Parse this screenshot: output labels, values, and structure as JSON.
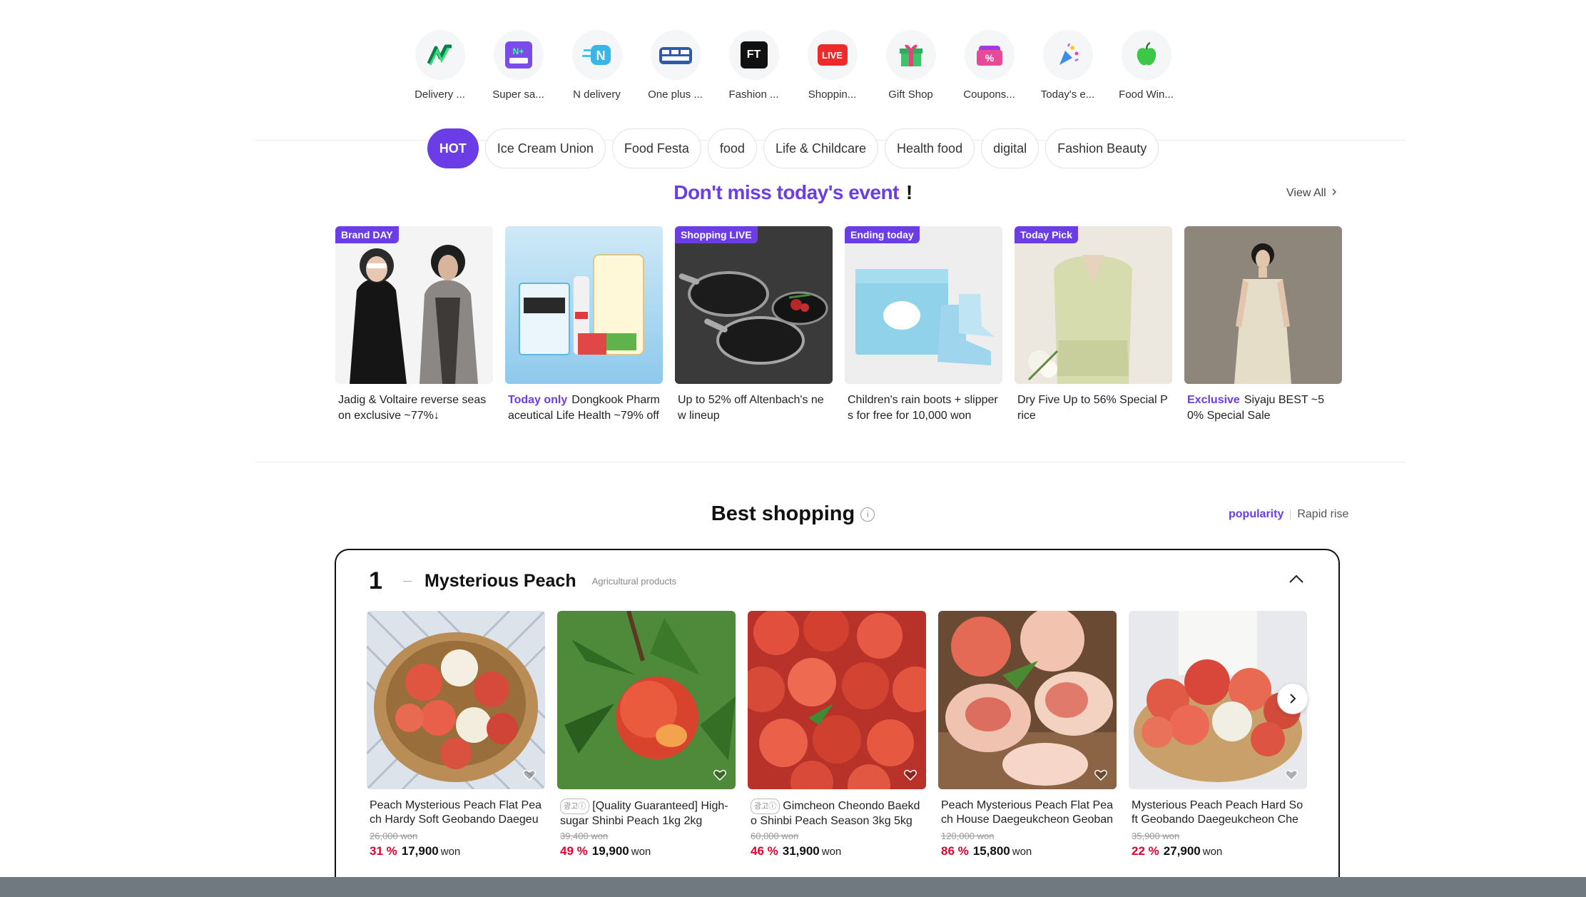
{
  "services": [
    {
      "label": "Delivery ...",
      "icon": "delivery-icon"
    },
    {
      "label": "Super sa...",
      "icon": "super-saving-icon"
    },
    {
      "label": "N delivery",
      "icon": "n-delivery-icon"
    },
    {
      "label": "One plus ...",
      "icon": "one-plus-icon"
    },
    {
      "label": "Fashion ...",
      "icon": "fashion-town-icon"
    },
    {
      "label": "Shoppin...",
      "icon": "shopping-live-icon"
    },
    {
      "label": "Gift Shop",
      "icon": "gift-icon"
    },
    {
      "label": "Coupons...",
      "icon": "coupon-icon"
    },
    {
      "label": "Today's e...",
      "icon": "party-popper-icon"
    },
    {
      "label": "Food Win...",
      "icon": "apple-icon"
    }
  ],
  "service_icon_text": {
    "ft": "FT",
    "live": "LIVE",
    "super": "N+"
  },
  "chips": [
    "HOT",
    "Ice Cream Union",
    "Food Festa",
    "food",
    "Life & Childcare",
    "Health food",
    "digital",
    "Fashion Beauty"
  ],
  "event": {
    "title": "Don't miss today's event",
    "bang": "!",
    "view_all": "View All",
    "cards": [
      {
        "badge": "Brand DAY",
        "highlight": "",
        "text": "Jadig & Voltaire reverse season exclusive ~77%↓"
      },
      {
        "badge": "",
        "highlight": "Today only",
        "text": "Dongkook Pharmaceutical Life Health ~79% off"
      },
      {
        "badge": "Shopping LIVE",
        "highlight": "",
        "text": "Up to 52% off Altenbach's new lineup"
      },
      {
        "badge": "Ending today",
        "highlight": "",
        "text": "Children's rain boots + slippers for free for 10,000 won"
      },
      {
        "badge": "Today Pick",
        "highlight": "",
        "text": "Dry Five Up to 56% Special Price"
      },
      {
        "badge": "",
        "highlight": "Exclusive",
        "text": "Siyaju BEST ~50% Special Sale"
      }
    ]
  },
  "best": {
    "title": "Best shopping",
    "info": "i",
    "sort_popularity": "popularity",
    "sort_rapid": "Rapid rise",
    "rank": "1",
    "rank_name": "Mysterious Peach",
    "rank_category": "Agricultural products",
    "products": [
      {
        "ad": "",
        "name": "Peach Mysterious Peach Flat Peach Hardy Soft Geobando Daegeuk...",
        "orig": "26,000 won",
        "discount": "31 %",
        "price": "17,900",
        "won": "won"
      },
      {
        "ad": "광고ⓘ",
        "name": "[Quality Guaranteed] High-sugar Shinbi Peach 1kg 2kg",
        "orig": "39,400 won",
        "discount": "49 %",
        "price": "19,900",
        "won": "won"
      },
      {
        "ad": "광고ⓘ",
        "name": "Gimcheon Cheondo Baekdo Shinbi Peach Season 3kg 5kg",
        "orig": "60,000 won",
        "discount": "46 %",
        "price": "31,900",
        "won": "won"
      },
      {
        "ad": "",
        "name": "Peach Mysterious Peach Flat Peach House Daegeukcheon Geoband...",
        "orig": "120,000 won",
        "discount": "86 %",
        "price": "15,800",
        "won": "won"
      },
      {
        "ad": "",
        "name": "Mysterious Peach Peach Hard Soft Geobando Daegeukcheon Cheon...",
        "orig": "35,900 won",
        "discount": "22 %",
        "price": "27,900",
        "won": "won"
      }
    ]
  },
  "colors": {
    "accent": "#6b3de6",
    "discount": "#e4002b"
  }
}
